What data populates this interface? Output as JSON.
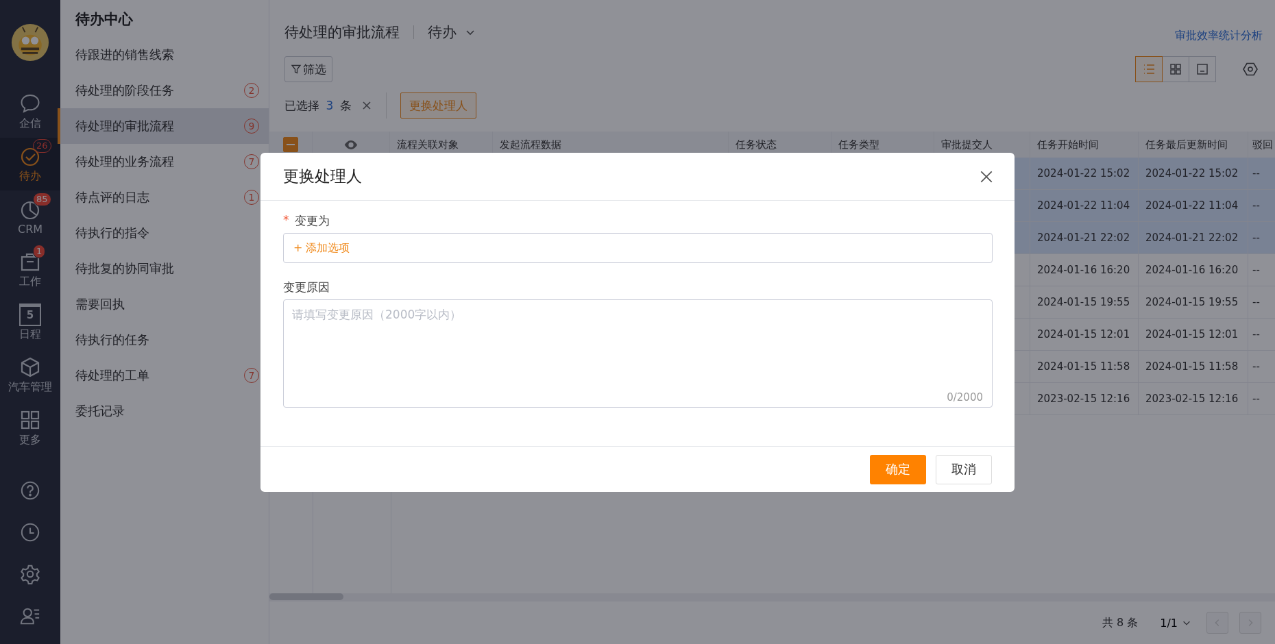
{
  "rail": {
    "items": [
      {
        "kind": "chat",
        "label": "企信",
        "selected": false
      },
      {
        "kind": "check",
        "label": "待办",
        "badge": "26",
        "selected": true
      },
      {
        "kind": "pie",
        "label": "CRM",
        "badge": "85",
        "selected": false
      },
      {
        "kind": "briefcase",
        "label": "工作",
        "badge": "1",
        "selected": false
      },
      {
        "kind": "calendar",
        "label": "日程",
        "day": "5",
        "selected": false
      },
      {
        "kind": "cube",
        "label": "汽车管理",
        "selected": false
      },
      {
        "kind": "grid",
        "label": "更多",
        "selected": false
      }
    ],
    "tools": [
      {
        "kind": "help"
      },
      {
        "kind": "clock"
      },
      {
        "kind": "gear"
      },
      {
        "kind": "contacts"
      }
    ]
  },
  "subnav": {
    "title": "待办中心",
    "items": [
      {
        "label": "待跟进的销售线索",
        "selected": false
      },
      {
        "label": "待处理的阶段任务",
        "count": "2",
        "selected": false
      },
      {
        "label": "待处理的审批流程",
        "count": "9",
        "selected": true
      },
      {
        "label": "待处理的业务流程",
        "count": "7",
        "selected": false
      },
      {
        "label": "待点评的日志",
        "count": "1",
        "selected": false
      },
      {
        "label": "待执行的指令",
        "selected": false
      },
      {
        "label": "待批复的协同审批",
        "selected": false
      },
      {
        "label": "需要回执",
        "selected": false
      },
      {
        "label": "待执行的任务",
        "selected": false
      },
      {
        "label": "待处理的工单",
        "count": "7",
        "selected": false
      },
      {
        "label": "委托记录",
        "selected": false
      }
    ]
  },
  "header": {
    "title": "待处理的审批流程",
    "scope": "待办",
    "link": "审批效率统计分析"
  },
  "toolbar": {
    "filter": "筛选",
    "views": [
      {
        "kind": "list",
        "selected": true
      },
      {
        "kind": "cards",
        "selected": false
      },
      {
        "kind": "panel",
        "selected": false
      }
    ]
  },
  "selection": {
    "prefix": "已选择",
    "count": "3",
    "suffix": "条",
    "action": "更换处理人"
  },
  "table": {
    "header_checkbox": {
      "indeterminate": true
    },
    "columns": [
      "流程关联对象",
      "发起流程数据",
      "任务状态",
      "任务类型",
      "审批提交人",
      "任务开始时间",
      "任务最后更新时间",
      "驳回"
    ],
    "rows": [
      {
        "start": "2024-01-22 15:02",
        "updated": "2024-01-22 15:02",
        "reject": "--",
        "selected": true
      },
      {
        "start": "2024-01-22 11:04",
        "updated": "2024-01-22 11:04",
        "reject": "--",
        "selected": true
      },
      {
        "start": "2024-01-21 22:02",
        "updated": "2024-01-21 22:02",
        "reject": "--",
        "selected": true
      },
      {
        "start": "2024-01-16 16:20",
        "updated": "2024-01-16 16:20",
        "reject": "--",
        "selected": false
      },
      {
        "start": "2024-01-15 19:55",
        "updated": "2024-01-15 19:55",
        "reject": "--",
        "selected": false
      },
      {
        "start": "2024-01-15 12:01",
        "updated": "2024-01-15 12:01",
        "reject": "--",
        "selected": false
      },
      {
        "start": "2024-01-15 11:58",
        "updated": "2024-01-15 11:58",
        "reject": "--",
        "selected": false
      },
      {
        "start": "2023-02-15 12:16",
        "updated": "2023-02-15 12:16",
        "reject": "--",
        "selected": false
      }
    ]
  },
  "pager": {
    "total": "共 8 条",
    "page": "1/1",
    "prev_disabled": true,
    "next_disabled": true
  },
  "dialog": {
    "title": "更换处理人",
    "fields": [
      {
        "kind": "picker",
        "label": "变更为",
        "required_mark": "*",
        "action": "+ 添加选项"
      },
      {
        "kind": "textarea",
        "label": "变更原因",
        "placeholder": "请填写变更原因（2000字以内）",
        "counter": "0/2000"
      }
    ],
    "ok": "确定",
    "cancel": "取消"
  }
}
